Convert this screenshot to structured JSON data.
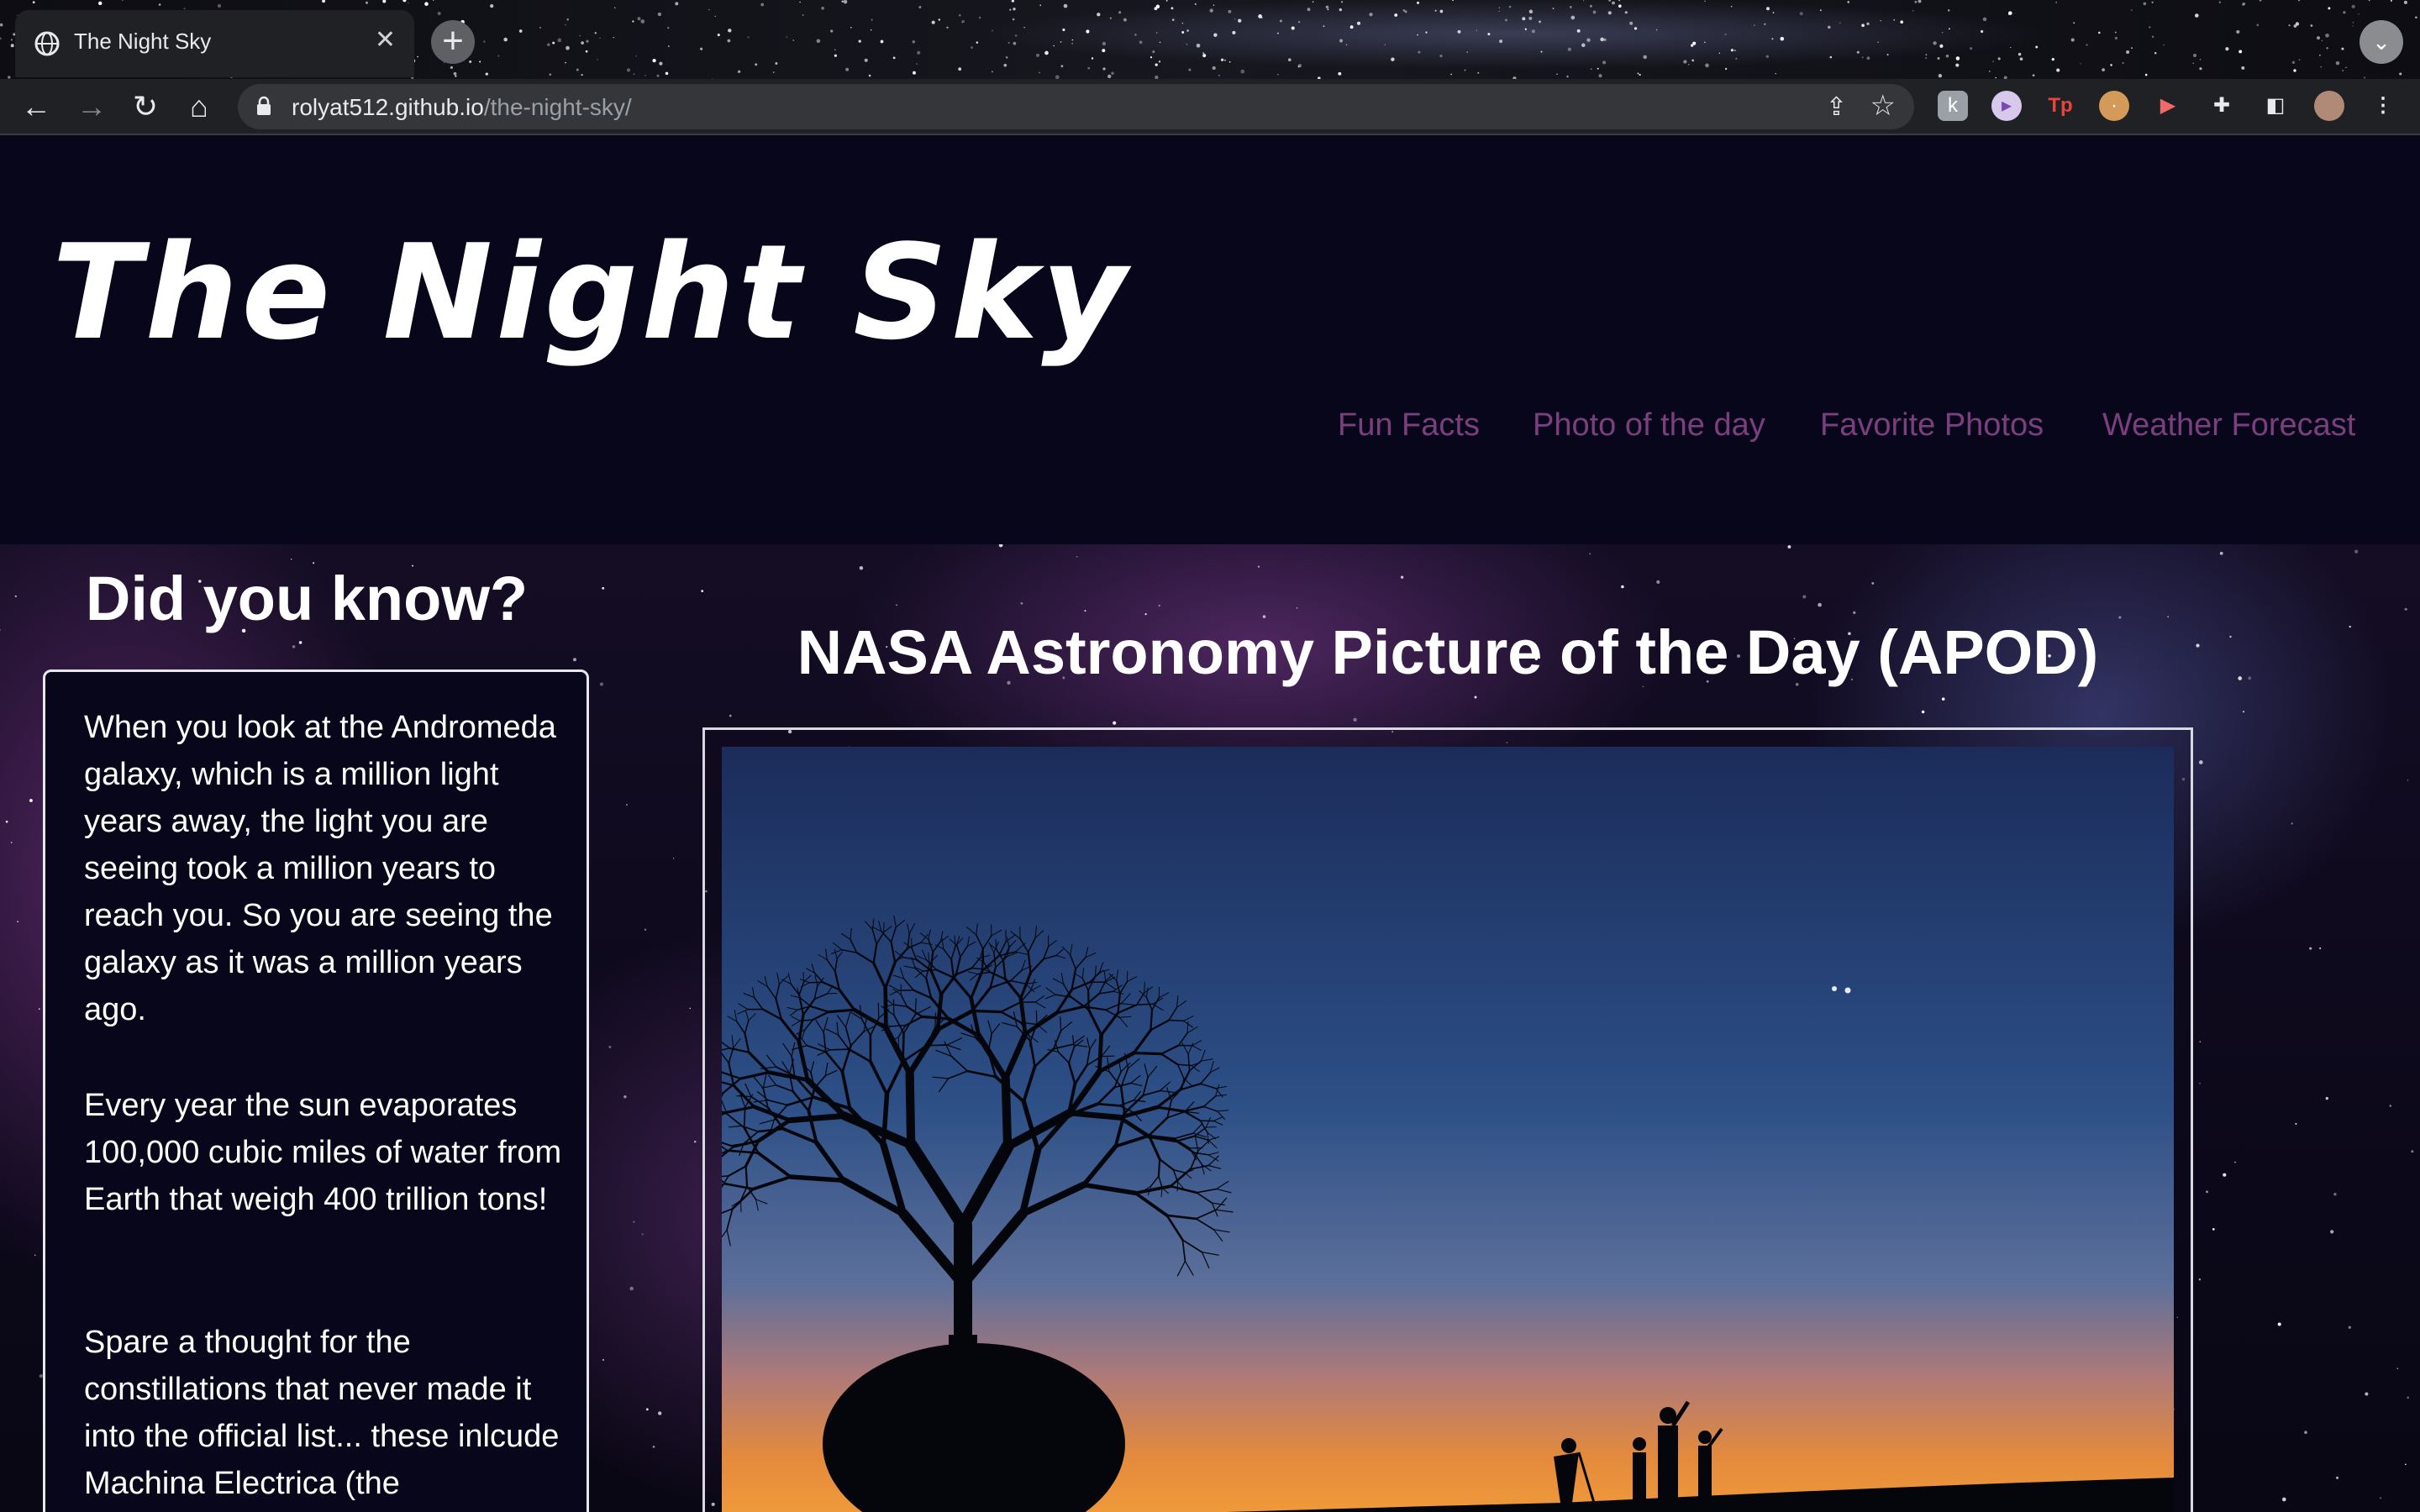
{
  "browser": {
    "tab_title": "The Night Sky",
    "tab_close": "✕",
    "new_tab": "+",
    "url_host": "rolyat512.github.io",
    "url_path": "/the-night-sky/",
    "profile_menu": "⌄"
  },
  "site": {
    "title": "The Night Sky",
    "nav": [
      "Fun Facts",
      "Photo of the day",
      "Favorite Photos",
      "Weather Forecast"
    ]
  },
  "facts": {
    "heading": "Did you know?",
    "items": [
      "When you look at the Andromeda galaxy, which is a million light years away, the light you are seeing took a million years to reach you. So you are seeing the galaxy as it was a million years ago.",
      "Every year the sun evaporates 100,000 cubic miles of water from Earth that weigh 400 trillion tons!",
      "Spare a thought for the constillations that never made it into the official list... these inlcude Machina Electrica (the"
    ]
  },
  "apod": {
    "heading": "NASA Astronomy Picture of the Day (APOD)"
  },
  "colors": {
    "page_bg": "#07061a",
    "nav_link": "#7b3f7e",
    "text": "#ffffff"
  },
  "icons": {
    "back": "back-arrow-icon",
    "forward": "forward-arrow-icon",
    "reload": "reload-icon",
    "home": "home-icon",
    "lock": "lock-icon",
    "share": "share-icon",
    "bookmark": "star-icon",
    "extensions": "puzzle-icon",
    "side_panel": "side-panel-icon",
    "menu": "kebab-menu-icon"
  }
}
